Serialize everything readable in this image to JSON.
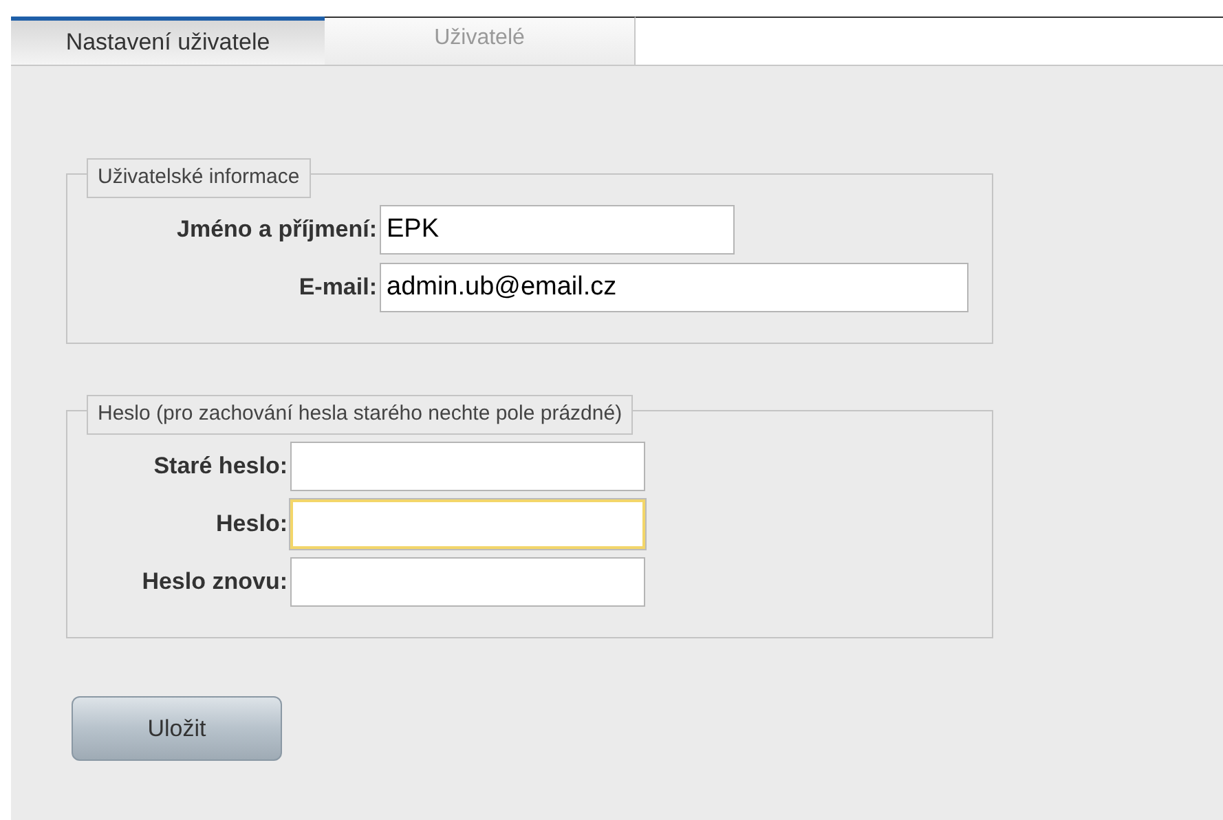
{
  "tabs": [
    {
      "label": "Nastavení uživatele",
      "selected": true
    },
    {
      "label": "Uživatelé",
      "selected": false
    }
  ],
  "sections": [
    {
      "legend": "Uživatelské informace",
      "fields": [
        {
          "label": "Jméno a příjmení:",
          "value": "EPK",
          "focused": false
        },
        {
          "label": "E-mail:",
          "value": "admin.ub@email.cz",
          "focused": false
        }
      ]
    },
    {
      "legend": "Heslo (pro zachování hesla starého nechte pole prázdné)",
      "fields": [
        {
          "label": "Staré heslo:",
          "focused": false
        },
        {
          "label": "Heslo:",
          "focused": true
        },
        {
          "label": "Heslo znovu:",
          "focused": false
        }
      ]
    }
  ],
  "save_button": "Uložit"
}
